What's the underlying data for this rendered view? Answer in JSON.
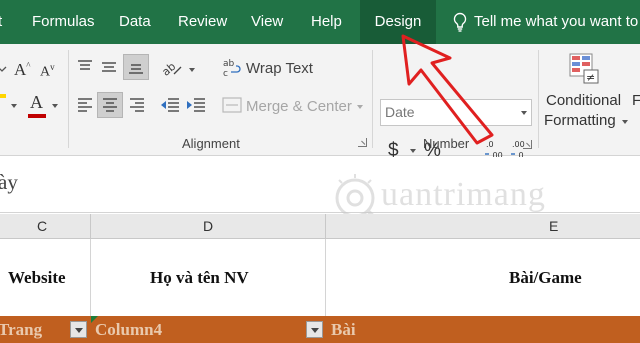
{
  "menu": {
    "tabs": [
      "t",
      "Formulas",
      "Data",
      "Review",
      "View",
      "Help",
      "Design"
    ],
    "active_tab": "Design",
    "tell_me": "Tell me what you want to"
  },
  "ribbon": {
    "wrap_text": "Wrap Text",
    "merge_center": "Merge & Center",
    "alignment_label": "Alignment",
    "number_format": "Date",
    "number_label": "Number",
    "currency_symbol": "$",
    "percent_symbol": "%",
    "conditional": "Conditional",
    "formatting": "Formatting",
    "next_group_initial": "F",
    "font_color": "#c00000",
    "fill_color": "#ffd500"
  },
  "formula_bar": {
    "text": "ày"
  },
  "watermark": {
    "text": "uantrimang"
  },
  "columns": {
    "letters": [
      "C",
      "D",
      "E"
    ],
    "headers": [
      "Website",
      "Họ và tên NV",
      "Bài/Game"
    ]
  },
  "table_row": {
    "cells": [
      "Trang",
      "Column4",
      "Bài"
    ],
    "color": "#c05f1f"
  },
  "annotation": {
    "arrow_color": "#e02020"
  }
}
